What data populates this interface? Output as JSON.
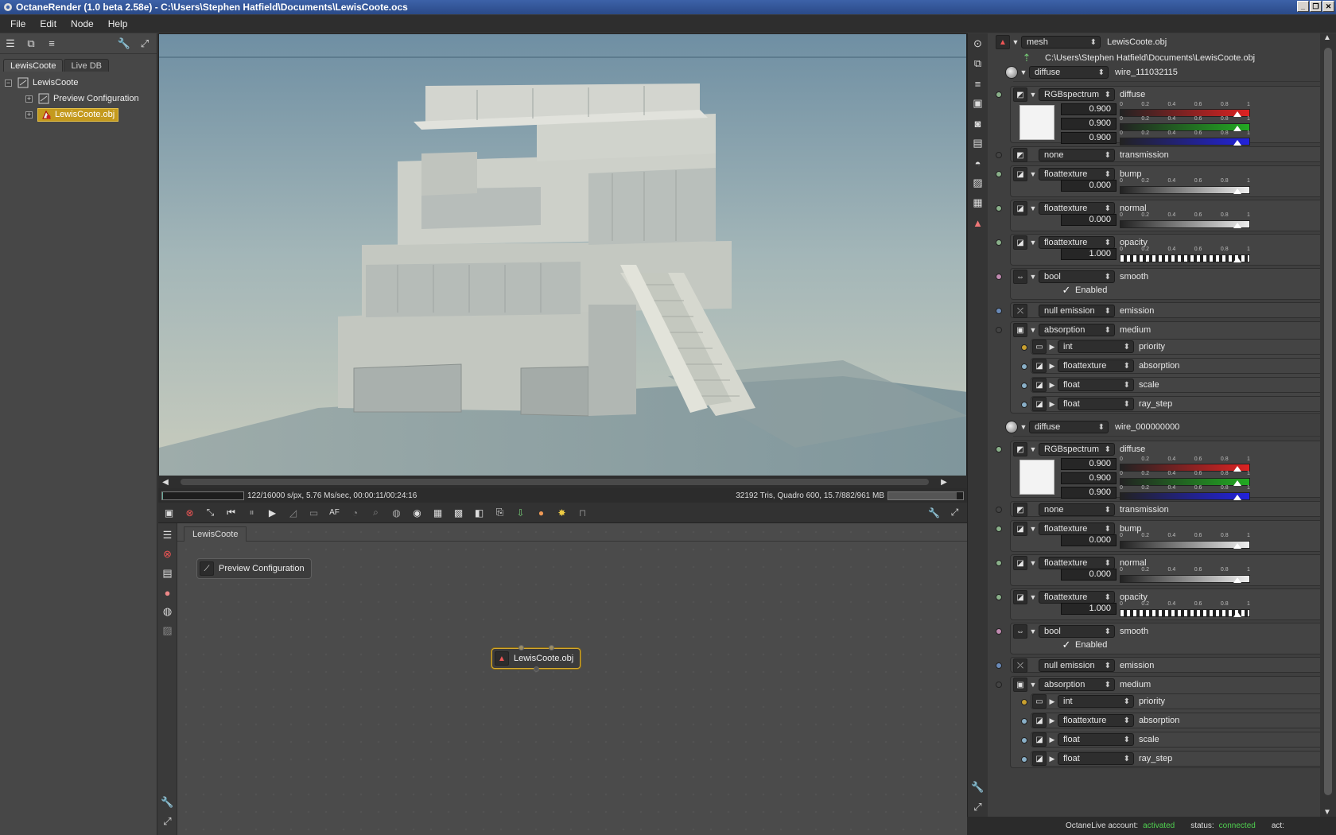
{
  "window": {
    "title": "OctaneRender (1.0 beta 2.58e) - C:\\Users\\Stephen Hatfield\\Documents\\LewisCoote.ocs"
  },
  "menu": [
    "File",
    "Edit",
    "Node",
    "Help"
  ],
  "outliner": {
    "tabs": [
      "LewisCoote",
      "Live DB"
    ],
    "tree": {
      "root": "LewisCoote",
      "children": [
        "Preview Configuration",
        "LewisCoote.obj"
      ]
    }
  },
  "render": {
    "status_left": "122/16000 s/px, 5.76 Ms/sec, 00:00:11/00:24:16",
    "status_right": "32192 Tris, Quadro 600, 15.7/882/961 MB",
    "sample_progress": 0.008,
    "vram_usage": 0.92
  },
  "graph": {
    "tab": "LewisCoote",
    "nodes": [
      "Preview Configuration",
      "LewisCoote.obj"
    ]
  },
  "inspector": {
    "mesh_type": "mesh",
    "mesh_name": "LewisCoote.obj",
    "mesh_path": "C:\\Users\\Stephen Hatfield\\Documents\\LewisCoote.obj",
    "materials": [
      {
        "type": "diffuse",
        "name": "wire_111032115",
        "diffuse": {
          "type": "RGBspectrum",
          "label": "diffuse",
          "r": "0.900",
          "g": "0.900",
          "b": "0.900"
        },
        "transmission": {
          "type": "none",
          "label": "transmission"
        },
        "bump": {
          "type": "floattexture",
          "label": "bump",
          "value": "0.000"
        },
        "normal": {
          "type": "floattexture",
          "label": "normal",
          "value": "0.000"
        },
        "opacity": {
          "type": "floattexture",
          "label": "opacity",
          "value": "1.000"
        },
        "smooth": {
          "type": "bool",
          "label": "smooth",
          "check": "Enabled"
        },
        "emission": {
          "type": "null emission",
          "label": "emission"
        },
        "medium": {
          "type": "absorption",
          "label": "medium",
          "params": [
            {
              "type": "int",
              "label": "priority"
            },
            {
              "type": "floattexture",
              "label": "absorption"
            },
            {
              "type": "float",
              "label": "scale"
            },
            {
              "type": "float",
              "label": "ray_step"
            }
          ]
        }
      },
      {
        "type": "diffuse",
        "name": "wire_000000000",
        "diffuse": {
          "type": "RGBspectrum",
          "label": "diffuse",
          "r": "0.900",
          "g": "0.900",
          "b": "0.900"
        },
        "transmission": {
          "type": "none",
          "label": "transmission"
        },
        "bump": {
          "type": "floattexture",
          "label": "bump",
          "value": "0.000"
        },
        "normal": {
          "type": "floattexture",
          "label": "normal",
          "value": "0.000"
        },
        "opacity": {
          "type": "floattexture",
          "label": "opacity",
          "value": "1.000"
        },
        "smooth": {
          "type": "bool",
          "label": "smooth",
          "check": "Enabled"
        },
        "emission": {
          "type": "null emission",
          "label": "emission"
        },
        "medium": {
          "type": "absorption",
          "label": "medium",
          "params": [
            {
              "type": "int",
              "label": "priority"
            },
            {
              "type": "floattexture",
              "label": "absorption"
            },
            {
              "type": "float",
              "label": "scale"
            },
            {
              "type": "float",
              "label": "ray_step"
            }
          ]
        }
      }
    ],
    "slider_ticks": [
      "0",
      "0.2",
      "0.4",
      "0.6",
      "0.8",
      "1"
    ]
  },
  "footer": {
    "account_label": "OctaneLive account:",
    "account_value": "activated",
    "status_label": "status:",
    "status_value": "connected",
    "act_label": "act:"
  },
  "colors": {
    "selection": "#c49a1e",
    "accent_green": "#4fd04f"
  }
}
